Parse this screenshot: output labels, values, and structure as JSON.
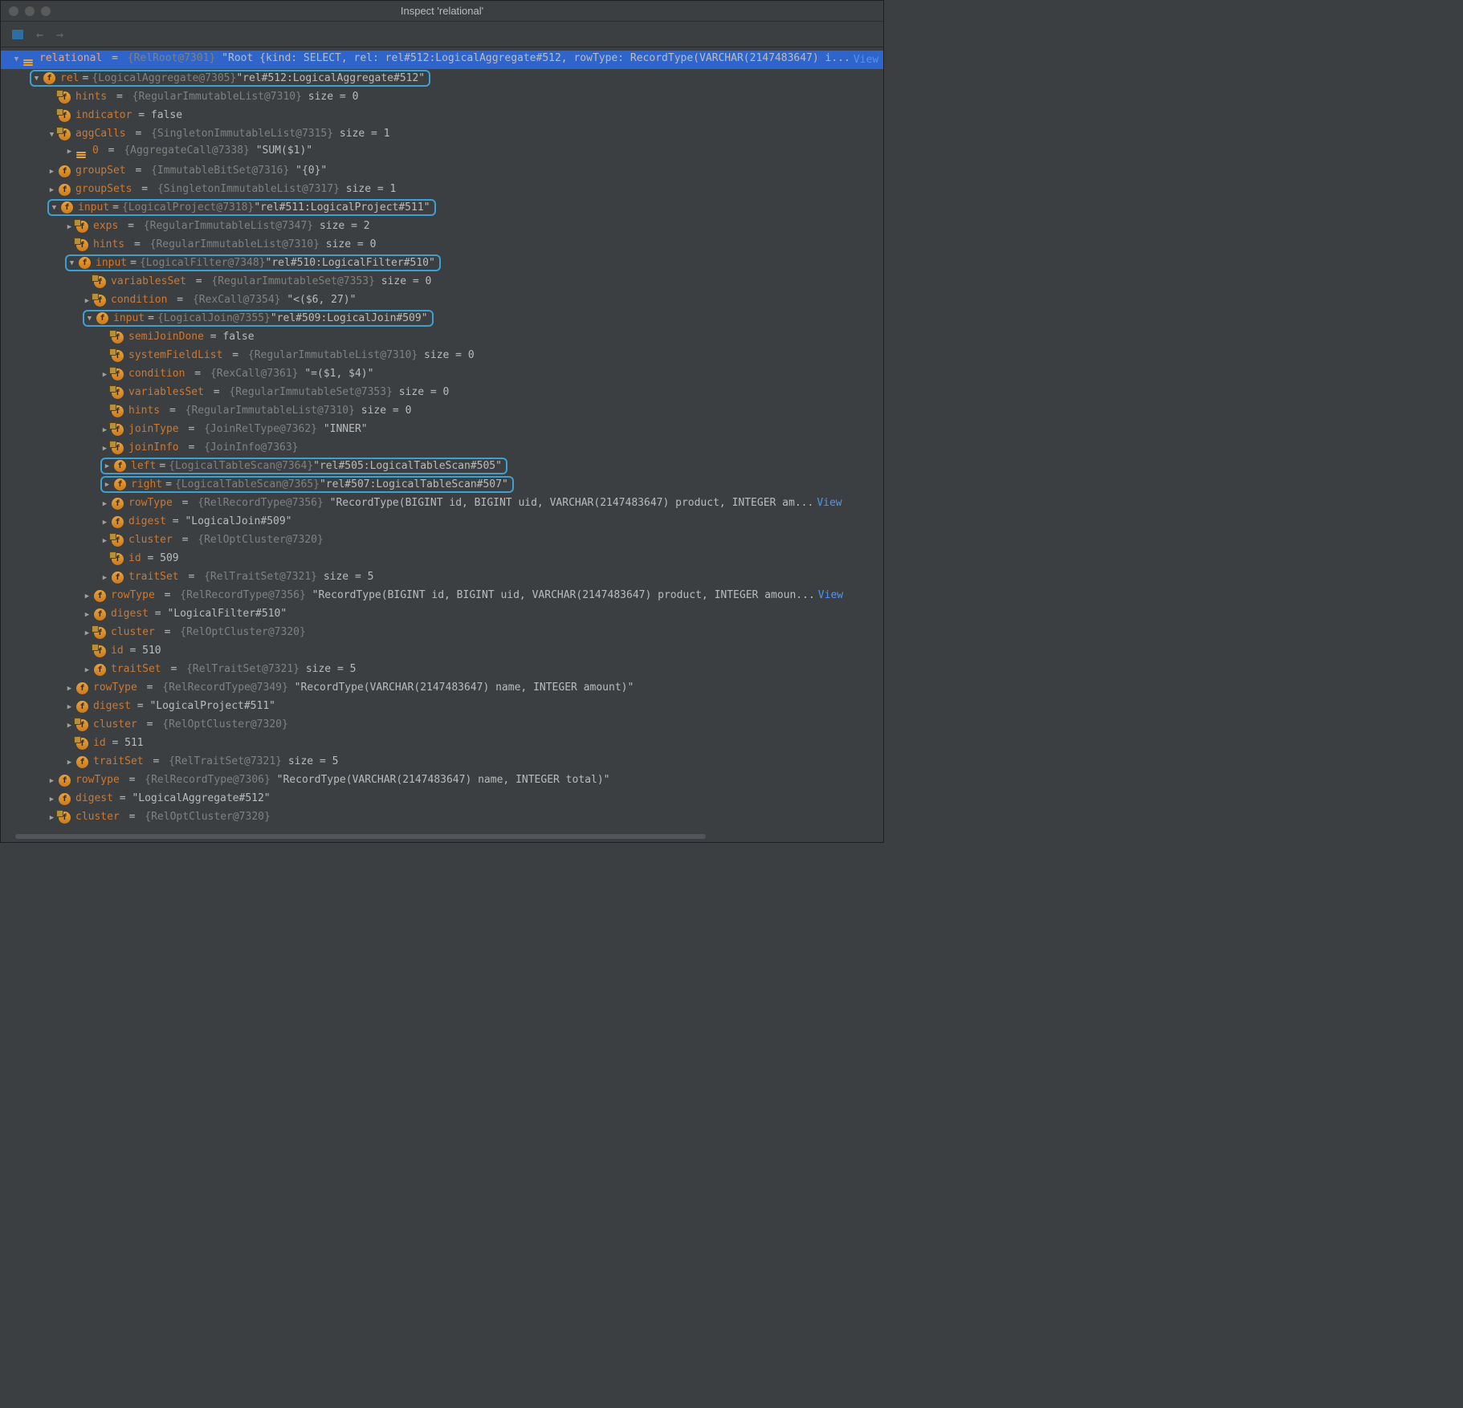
{
  "window": {
    "title": "Inspect 'relational'"
  },
  "common": {
    "eq": "=",
    "view": "View"
  },
  "rows": [
    {
      "depth": 0,
      "t": "expanded",
      "icon": "obj",
      "selected": true,
      "k": "relational",
      "typ": "{RelRoot@7301}",
      "str": "\"Root {kind: SELECT, rel: rel#512:LogicalAggregate#512, rowType: RecordType(VARCHAR(2147483647) i...",
      "view": true
    },
    {
      "depth": 1,
      "t": "expanded",
      "icon": "f",
      "hl": true,
      "k": "rel",
      "typ": "{LogicalAggregate@7305}",
      "str": "\"rel#512:LogicalAggregate#512\""
    },
    {
      "depth": 2,
      "t": "none",
      "icon": "fl",
      "k": "hints",
      "typ": "{RegularImmutableList@7310}",
      "val": "size = 0"
    },
    {
      "depth": 2,
      "t": "none",
      "icon": "fl",
      "k": "indicator",
      "val": "= false"
    },
    {
      "depth": 2,
      "t": "expanded",
      "icon": "fl",
      "k": "aggCalls",
      "typ": "{SingletonImmutableList@7315}",
      "val": "size = 1"
    },
    {
      "depth": 3,
      "t": "collapsed",
      "icon": "obj",
      "k": "0",
      "typ": "{AggregateCall@7338}",
      "str": "\"SUM($1)\""
    },
    {
      "depth": 2,
      "t": "collapsed",
      "icon": "f",
      "k": "groupSet",
      "typ": "{ImmutableBitSet@7316}",
      "str": "\"{0}\""
    },
    {
      "depth": 2,
      "t": "collapsed",
      "icon": "f",
      "k": "groupSets",
      "typ": "{SingletonImmutableList@7317}",
      "val": "size = 1"
    },
    {
      "depth": 2,
      "t": "expanded",
      "icon": "f",
      "hl": true,
      "k": "input",
      "typ": "{LogicalProject@7318}",
      "str": "\"rel#511:LogicalProject#511\""
    },
    {
      "depth": 3,
      "t": "collapsed",
      "icon": "fl",
      "k": "exps",
      "typ": "{RegularImmutableList@7347}",
      "val": "size = 2"
    },
    {
      "depth": 3,
      "t": "none",
      "icon": "fl",
      "k": "hints",
      "typ": "{RegularImmutableList@7310}",
      "val": "size = 0"
    },
    {
      "depth": 3,
      "t": "expanded",
      "icon": "f",
      "hl": true,
      "k": "input",
      "typ": "{LogicalFilter@7348}",
      "str": "\"rel#510:LogicalFilter#510\""
    },
    {
      "depth": 4,
      "t": "none",
      "icon": "fl",
      "k": "variablesSet",
      "typ": "{RegularImmutableSet@7353}",
      "val": "size = 0"
    },
    {
      "depth": 4,
      "t": "collapsed",
      "icon": "fl",
      "k": "condition",
      "typ": "{RexCall@7354}",
      "str": "\"<($6, 27)\""
    },
    {
      "depth": 4,
      "t": "expanded",
      "icon": "f",
      "hl": true,
      "k": "input",
      "typ": "{LogicalJoin@7355}",
      "str": "\"rel#509:LogicalJoin#509\""
    },
    {
      "depth": 5,
      "t": "none",
      "icon": "fl",
      "k": "semiJoinDone",
      "val": "= false"
    },
    {
      "depth": 5,
      "t": "none",
      "icon": "fl",
      "k": "systemFieldList",
      "typ": "{RegularImmutableList@7310}",
      "val": "size = 0"
    },
    {
      "depth": 5,
      "t": "collapsed",
      "icon": "fl",
      "k": "condition",
      "typ": "{RexCall@7361}",
      "str": "\"=($1, $4)\""
    },
    {
      "depth": 5,
      "t": "none",
      "icon": "fl",
      "k": "variablesSet",
      "typ": "{RegularImmutableSet@7353}",
      "val": "size = 0"
    },
    {
      "depth": 5,
      "t": "none",
      "icon": "fl",
      "k": "hints",
      "typ": "{RegularImmutableList@7310}",
      "val": "size = 0"
    },
    {
      "depth": 5,
      "t": "collapsed",
      "icon": "fl",
      "k": "joinType",
      "typ": "{JoinRelType@7362}",
      "str": "\"INNER\""
    },
    {
      "depth": 5,
      "t": "collapsed",
      "icon": "fl",
      "k": "joinInfo",
      "typ": "{JoinInfo@7363}"
    },
    {
      "depth": 5,
      "t": "collapsed",
      "icon": "f",
      "hl": true,
      "k": "left",
      "typ": "{LogicalTableScan@7364}",
      "str": "\"rel#505:LogicalTableScan#505\""
    },
    {
      "depth": 5,
      "t": "collapsed",
      "icon": "f",
      "hl": true,
      "k": "right",
      "typ": "{LogicalTableScan@7365}",
      "str": "\"rel#507:LogicalTableScan#507\""
    },
    {
      "depth": 5,
      "t": "collapsed",
      "icon": "f",
      "k": "rowType",
      "typ": "{RelRecordType@7356}",
      "str": "\"RecordType(BIGINT id, BIGINT uid, VARCHAR(2147483647) product, INTEGER am...",
      "view": true
    },
    {
      "depth": 5,
      "t": "collapsed",
      "icon": "f",
      "k": "digest",
      "str": "= \"LogicalJoin#509\""
    },
    {
      "depth": 5,
      "t": "collapsed",
      "icon": "fl",
      "k": "cluster",
      "typ": "{RelOptCluster@7320}"
    },
    {
      "depth": 5,
      "t": "none",
      "icon": "fl",
      "k": "id",
      "val": "= 509"
    },
    {
      "depth": 5,
      "t": "collapsed",
      "icon": "f",
      "k": "traitSet",
      "typ": "{RelTraitSet@7321}",
      "val": "size = 5"
    },
    {
      "depth": 4,
      "t": "collapsed",
      "icon": "f",
      "k": "rowType",
      "typ": "{RelRecordType@7356}",
      "str": "\"RecordType(BIGINT id, BIGINT uid, VARCHAR(2147483647) product, INTEGER amoun...",
      "view": true
    },
    {
      "depth": 4,
      "t": "collapsed",
      "icon": "f",
      "k": "digest",
      "str": "= \"LogicalFilter#510\""
    },
    {
      "depth": 4,
      "t": "collapsed",
      "icon": "fl",
      "k": "cluster",
      "typ": "{RelOptCluster@7320}"
    },
    {
      "depth": 4,
      "t": "none",
      "icon": "fl",
      "k": "id",
      "val": "= 510"
    },
    {
      "depth": 4,
      "t": "collapsed",
      "icon": "f",
      "k": "traitSet",
      "typ": "{RelTraitSet@7321}",
      "val": "size = 5"
    },
    {
      "depth": 3,
      "t": "collapsed",
      "icon": "f",
      "k": "rowType",
      "typ": "{RelRecordType@7349}",
      "str": "\"RecordType(VARCHAR(2147483647) name, INTEGER amount)\""
    },
    {
      "depth": 3,
      "t": "collapsed",
      "icon": "f",
      "k": "digest",
      "str": "= \"LogicalProject#511\""
    },
    {
      "depth": 3,
      "t": "collapsed",
      "icon": "fl",
      "k": "cluster",
      "typ": "{RelOptCluster@7320}"
    },
    {
      "depth": 3,
      "t": "none",
      "icon": "fl",
      "k": "id",
      "val": "= 511"
    },
    {
      "depth": 3,
      "t": "collapsed",
      "icon": "f",
      "k": "traitSet",
      "typ": "{RelTraitSet@7321}",
      "val": "size = 5"
    },
    {
      "depth": 2,
      "t": "collapsed",
      "icon": "f",
      "k": "rowType",
      "typ": "{RelRecordType@7306}",
      "str": "\"RecordType(VARCHAR(2147483647) name, INTEGER total)\""
    },
    {
      "depth": 2,
      "t": "collapsed",
      "icon": "f",
      "k": "digest",
      "str": "= \"LogicalAggregate#512\""
    },
    {
      "depth": 2,
      "t": "collapsed",
      "icon": "fl",
      "k": "cluster",
      "typ": "{RelOptCluster@7320}"
    }
  ]
}
